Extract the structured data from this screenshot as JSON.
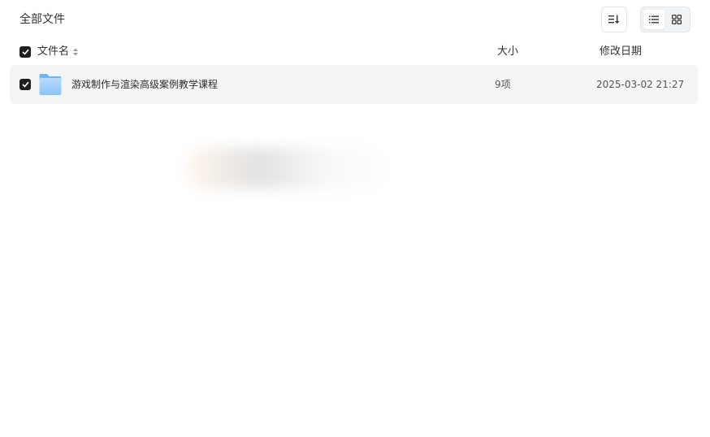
{
  "breadcrumb": {
    "title": "全部文件"
  },
  "toolbar": {
    "sort_icon": "sort-descending-icon",
    "view_modes": [
      {
        "name": "list",
        "icon": "list-view-icon",
        "active": true
      },
      {
        "name": "grid",
        "icon": "grid-view-icon",
        "active": false
      }
    ]
  },
  "table": {
    "columns": {
      "name": "文件名",
      "size": "大小",
      "date": "修改日期"
    },
    "rows": [
      {
        "type": "folder",
        "name": "游戏制作与渲染高级案例教学课程",
        "size": "9项",
        "modified": "2025-03-02 21:27",
        "checked": true
      }
    ]
  },
  "colors": {
    "checkbox": "#1f1f1f",
    "row_bg": "#f5f5f6",
    "folder_light": "#a9d4fb",
    "folder_dark": "#6fb3f5"
  }
}
